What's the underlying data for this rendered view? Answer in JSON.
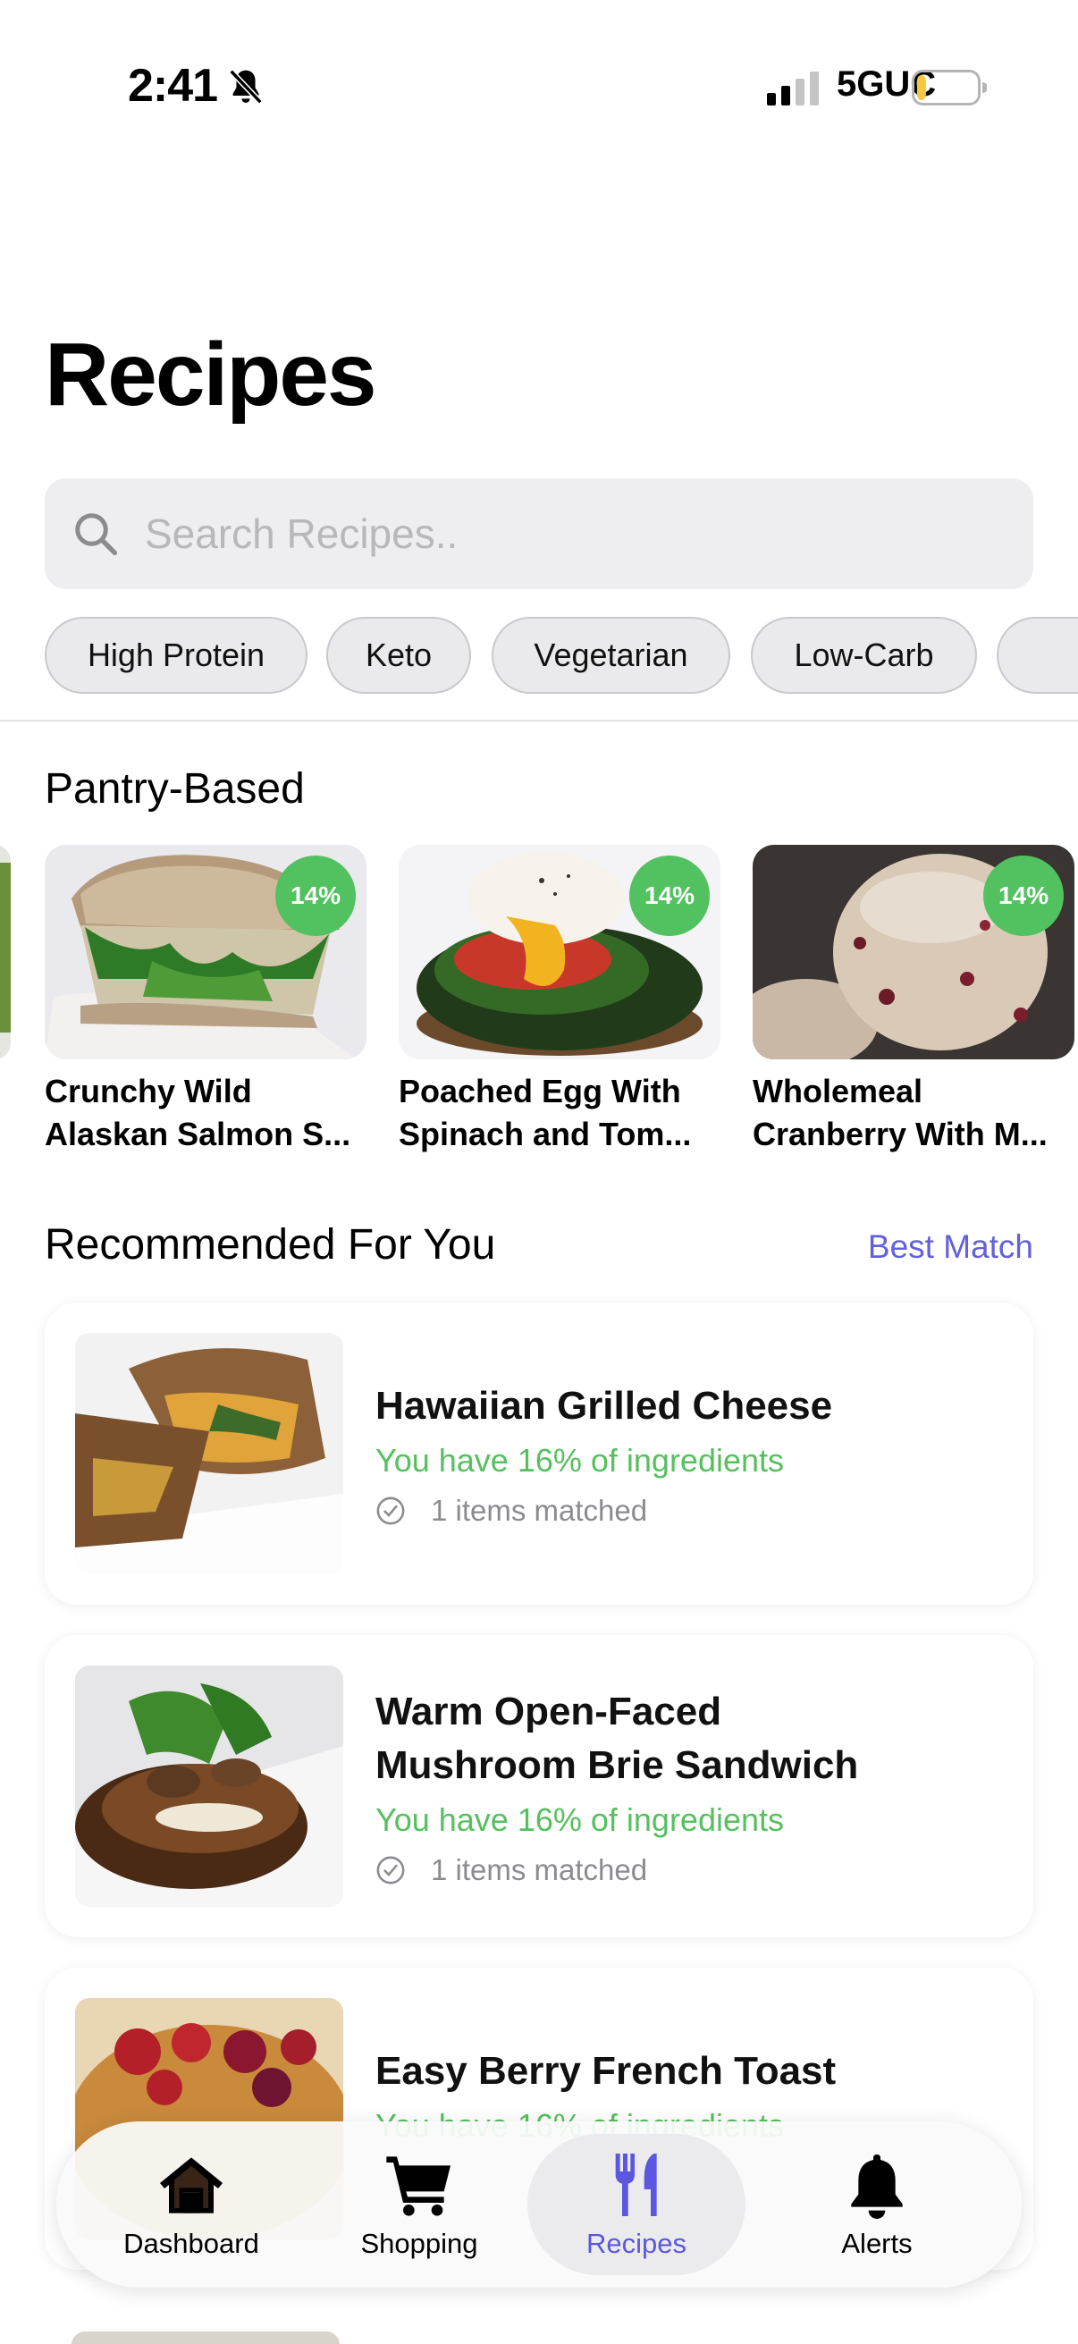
{
  "status_bar": {
    "time": "2:41",
    "network": "5GUC",
    "battery_level": 0.15
  },
  "page": {
    "title": "Recipes"
  },
  "search": {
    "placeholder": "Search Recipes.."
  },
  "filters": [
    {
      "label": "High Protein"
    },
    {
      "label": "Keto"
    },
    {
      "label": "Vegetarian"
    },
    {
      "label": "Low-Carb"
    },
    {
      "label": ""
    }
  ],
  "pantry_section": {
    "title": "Pantry-Based",
    "items": [
      {
        "line1": "Crunchy Wild",
        "line2": "Alaskan Salmon S...",
        "percent": "14%",
        "image": "salmon-sandwich-photo"
      },
      {
        "line1": "Poached Egg With",
        "line2": "Spinach and Tom...",
        "percent": "14%",
        "image": "poached-egg-photo"
      },
      {
        "line1": "Wholemeal",
        "line2": "Cranberry With M...",
        "percent": "14%",
        "image": "cranberry-bread-photo"
      }
    ]
  },
  "recommended_section": {
    "title": "Recommended For You",
    "sort_label": "Best Match",
    "items": [
      {
        "name_line1": "Hawaiian Grilled Cheese",
        "name_line2": "",
        "have": "You have 16% of ingredients",
        "matched": "1 items matched",
        "image": "grilled-cheese-photo"
      },
      {
        "name_line1": "Warm Open-Faced",
        "name_line2": "Mushroom Brie Sandwich",
        "have": "You have 16% of ingredients",
        "matched": "1 items matched",
        "image": "mushroom-sandwich-photo"
      },
      {
        "name_line1": "Easy Berry French Toast",
        "name_line2": "",
        "have": "You have 16% of ingredients",
        "matched": "",
        "image": "french-toast-photo"
      }
    ]
  },
  "tab_bar": {
    "tabs": [
      {
        "label": "Dashboard",
        "icon": "house-icon",
        "active": false
      },
      {
        "label": "Shopping",
        "icon": "cart-icon",
        "active": false
      },
      {
        "label": "Recipes",
        "icon": "fork-knife-icon",
        "active": true
      },
      {
        "label": "Alerts",
        "icon": "bell-icon",
        "active": false
      }
    ]
  },
  "colors": {
    "accent": "#5b57e0",
    "match_green": "#52c15f",
    "search_bg": "#eeeef0"
  }
}
